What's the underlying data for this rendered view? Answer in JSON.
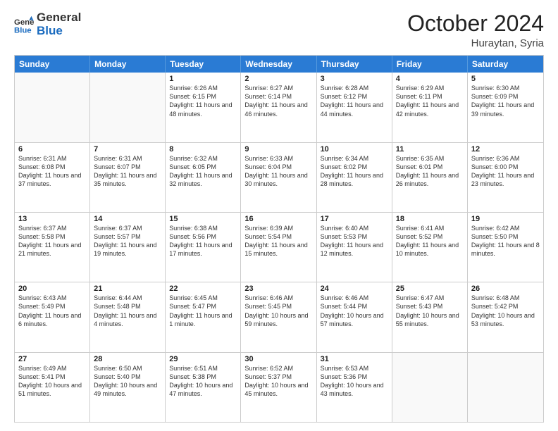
{
  "logo": {
    "line1": "General",
    "line2": "Blue"
  },
  "title": "October 2024",
  "location": "Huraytan, Syria",
  "days": [
    "Sunday",
    "Monday",
    "Tuesday",
    "Wednesday",
    "Thursday",
    "Friday",
    "Saturday"
  ],
  "weeks": [
    [
      {
        "day": "",
        "text": ""
      },
      {
        "day": "",
        "text": ""
      },
      {
        "day": "1",
        "text": "Sunrise: 6:26 AM\nSunset: 6:15 PM\nDaylight: 11 hours and 48 minutes."
      },
      {
        "day": "2",
        "text": "Sunrise: 6:27 AM\nSunset: 6:14 PM\nDaylight: 11 hours and 46 minutes."
      },
      {
        "day": "3",
        "text": "Sunrise: 6:28 AM\nSunset: 6:12 PM\nDaylight: 11 hours and 44 minutes."
      },
      {
        "day": "4",
        "text": "Sunrise: 6:29 AM\nSunset: 6:11 PM\nDaylight: 11 hours and 42 minutes."
      },
      {
        "day": "5",
        "text": "Sunrise: 6:30 AM\nSunset: 6:09 PM\nDaylight: 11 hours and 39 minutes."
      }
    ],
    [
      {
        "day": "6",
        "text": "Sunrise: 6:31 AM\nSunset: 6:08 PM\nDaylight: 11 hours and 37 minutes."
      },
      {
        "day": "7",
        "text": "Sunrise: 6:31 AM\nSunset: 6:07 PM\nDaylight: 11 hours and 35 minutes."
      },
      {
        "day": "8",
        "text": "Sunrise: 6:32 AM\nSunset: 6:05 PM\nDaylight: 11 hours and 32 minutes."
      },
      {
        "day": "9",
        "text": "Sunrise: 6:33 AM\nSunset: 6:04 PM\nDaylight: 11 hours and 30 minutes."
      },
      {
        "day": "10",
        "text": "Sunrise: 6:34 AM\nSunset: 6:02 PM\nDaylight: 11 hours and 28 minutes."
      },
      {
        "day": "11",
        "text": "Sunrise: 6:35 AM\nSunset: 6:01 PM\nDaylight: 11 hours and 26 minutes."
      },
      {
        "day": "12",
        "text": "Sunrise: 6:36 AM\nSunset: 6:00 PM\nDaylight: 11 hours and 23 minutes."
      }
    ],
    [
      {
        "day": "13",
        "text": "Sunrise: 6:37 AM\nSunset: 5:58 PM\nDaylight: 11 hours and 21 minutes."
      },
      {
        "day": "14",
        "text": "Sunrise: 6:37 AM\nSunset: 5:57 PM\nDaylight: 11 hours and 19 minutes."
      },
      {
        "day": "15",
        "text": "Sunrise: 6:38 AM\nSunset: 5:56 PM\nDaylight: 11 hours and 17 minutes."
      },
      {
        "day": "16",
        "text": "Sunrise: 6:39 AM\nSunset: 5:54 PM\nDaylight: 11 hours and 15 minutes."
      },
      {
        "day": "17",
        "text": "Sunrise: 6:40 AM\nSunset: 5:53 PM\nDaylight: 11 hours and 12 minutes."
      },
      {
        "day": "18",
        "text": "Sunrise: 6:41 AM\nSunset: 5:52 PM\nDaylight: 11 hours and 10 minutes."
      },
      {
        "day": "19",
        "text": "Sunrise: 6:42 AM\nSunset: 5:50 PM\nDaylight: 11 hours and 8 minutes."
      }
    ],
    [
      {
        "day": "20",
        "text": "Sunrise: 6:43 AM\nSunset: 5:49 PM\nDaylight: 11 hours and 6 minutes."
      },
      {
        "day": "21",
        "text": "Sunrise: 6:44 AM\nSunset: 5:48 PM\nDaylight: 11 hours and 4 minutes."
      },
      {
        "day": "22",
        "text": "Sunrise: 6:45 AM\nSunset: 5:47 PM\nDaylight: 11 hours and 1 minute."
      },
      {
        "day": "23",
        "text": "Sunrise: 6:46 AM\nSunset: 5:45 PM\nDaylight: 10 hours and 59 minutes."
      },
      {
        "day": "24",
        "text": "Sunrise: 6:46 AM\nSunset: 5:44 PM\nDaylight: 10 hours and 57 minutes."
      },
      {
        "day": "25",
        "text": "Sunrise: 6:47 AM\nSunset: 5:43 PM\nDaylight: 10 hours and 55 minutes."
      },
      {
        "day": "26",
        "text": "Sunrise: 6:48 AM\nSunset: 5:42 PM\nDaylight: 10 hours and 53 minutes."
      }
    ],
    [
      {
        "day": "27",
        "text": "Sunrise: 6:49 AM\nSunset: 5:41 PM\nDaylight: 10 hours and 51 minutes."
      },
      {
        "day": "28",
        "text": "Sunrise: 6:50 AM\nSunset: 5:40 PM\nDaylight: 10 hours and 49 minutes."
      },
      {
        "day": "29",
        "text": "Sunrise: 6:51 AM\nSunset: 5:38 PM\nDaylight: 10 hours and 47 minutes."
      },
      {
        "day": "30",
        "text": "Sunrise: 6:52 AM\nSunset: 5:37 PM\nDaylight: 10 hours and 45 minutes."
      },
      {
        "day": "31",
        "text": "Sunrise: 6:53 AM\nSunset: 5:36 PM\nDaylight: 10 hours and 43 minutes."
      },
      {
        "day": "",
        "text": ""
      },
      {
        "day": "",
        "text": ""
      }
    ]
  ]
}
